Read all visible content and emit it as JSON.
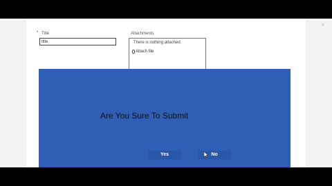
{
  "form": {
    "title_label": "Title",
    "required_mark": "*",
    "title_value": "title",
    "attachments_label": "Attachments",
    "attachments_empty": "There is nothing attached.",
    "attach_file_label": "Attach file",
    "close_glyph": "×"
  },
  "dialog": {
    "message": "Are You Sure To Submit",
    "yes_label": "Yes",
    "no_label": "No",
    "background_color": "#2f5fb4"
  },
  "icons": {
    "close": "close-icon",
    "paperclip": "paperclip-icon",
    "cursor": "mouse-pointer-icon"
  }
}
